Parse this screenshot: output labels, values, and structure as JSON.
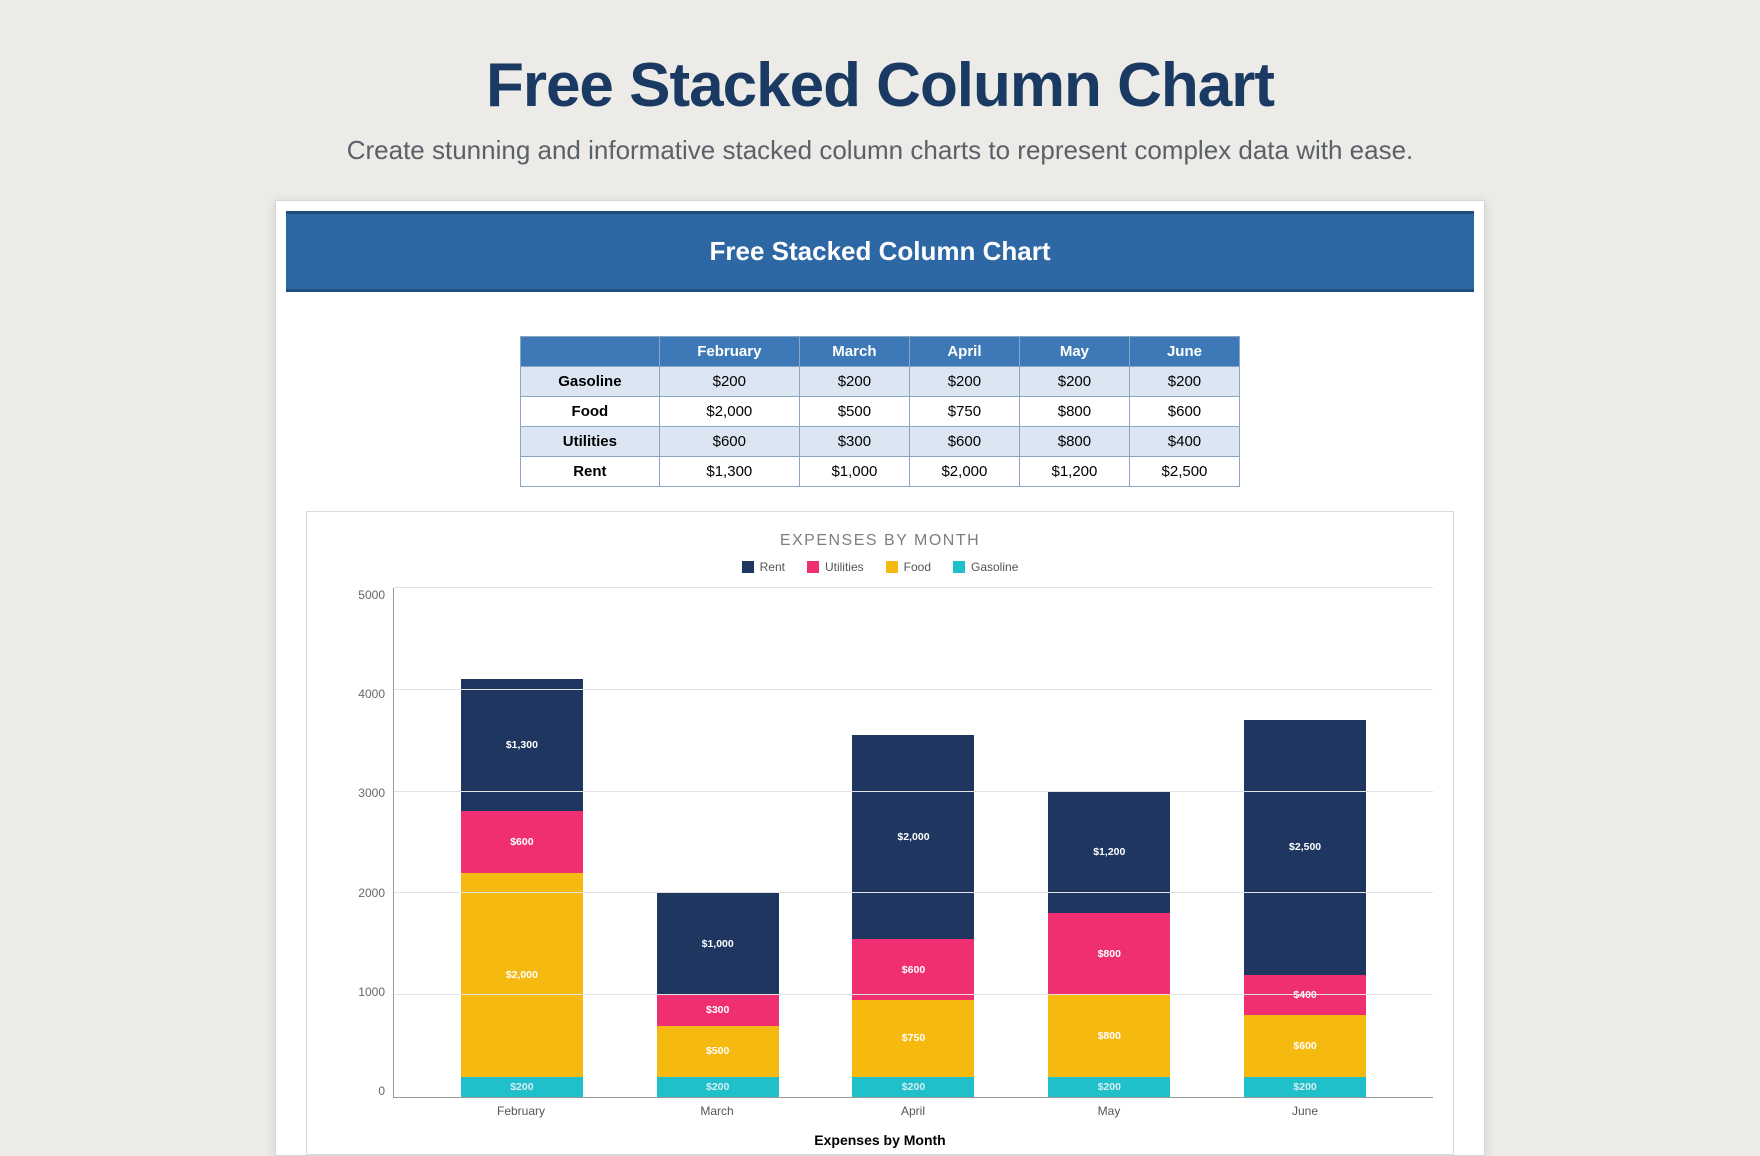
{
  "hero": {
    "title": "Free Stacked Column Chart",
    "subtitle": "Create stunning and informative stacked column charts to represent complex data with ease."
  },
  "card": {
    "banner": "Free Stacked Column Chart"
  },
  "table": {
    "columns": [
      "February",
      "March",
      "April",
      "May",
      "June"
    ],
    "rows": [
      {
        "label": "Gasoline",
        "values": [
          "$200",
          "$200",
          "$200",
          "$200",
          "$200"
        ]
      },
      {
        "label": "Food",
        "values": [
          "$2,000",
          "$500",
          "$750",
          "$800",
          "$600"
        ]
      },
      {
        "label": "Utilities",
        "values": [
          "$600",
          "$300",
          "$600",
          "$800",
          "$400"
        ]
      },
      {
        "label": "Rent",
        "values": [
          "$1,300",
          "$1,000",
          "$2,000",
          "$1,200",
          "$2,500"
        ]
      }
    ]
  },
  "chart_data": {
    "type": "bar",
    "stacked": true,
    "title": "EXPENSES BY MONTH",
    "xlabel": "Expenses by Month",
    "ylabel": "",
    "ylim": [
      0,
      5000
    ],
    "yticks": [
      0,
      1000,
      2000,
      3000,
      4000,
      5000
    ],
    "categories": [
      "February",
      "March",
      "April",
      "May",
      "June"
    ],
    "series": [
      {
        "name": "Rent",
        "color": "#1f3760",
        "values": [
          1300,
          1000,
          2000,
          1200,
          2500
        ],
        "labels": [
          "$1,300",
          "$1,000",
          "$2,000",
          "$1,200",
          "$2,500"
        ]
      },
      {
        "name": "Utilities",
        "color": "#ef2f72",
        "values": [
          600,
          300,
          600,
          800,
          400
        ],
        "labels": [
          "$600",
          "$300",
          "$600",
          "$800",
          "$400"
        ]
      },
      {
        "name": "Food",
        "color": "#f6b90f",
        "values": [
          2000,
          500,
          750,
          800,
          600
        ],
        "labels": [
          "$2,000",
          "$500",
          "$750",
          "$800",
          "$600"
        ]
      },
      {
        "name": "Gasoline",
        "color": "#1fc0c9",
        "values": [
          200,
          200,
          200,
          200,
          200
        ],
        "labels": [
          "$200",
          "$200",
          "$200",
          "$200",
          "$200"
        ]
      }
    ],
    "legend_order": [
      "Rent",
      "Utilities",
      "Food",
      "Gasoline"
    ]
  }
}
